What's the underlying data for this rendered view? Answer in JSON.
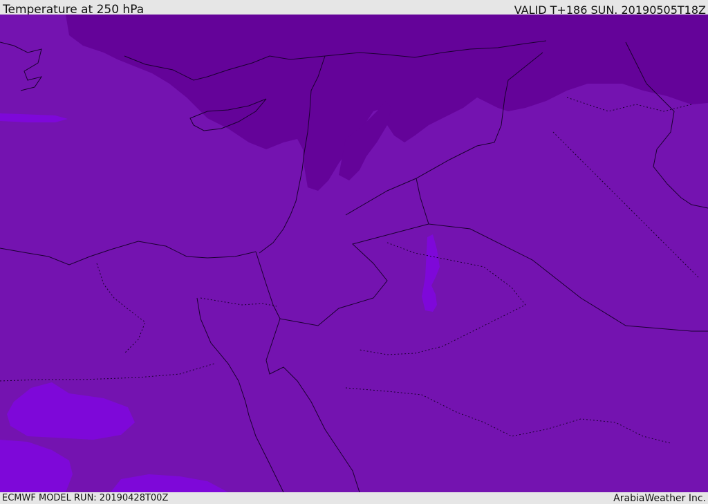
{
  "header": {
    "title": "Temperature at 250 hPa",
    "valid_time": "VALID T+186 SUN. 20190505T18Z"
  },
  "footer": {
    "model_run": "ECMWF MODEL RUN: 20190428T00Z",
    "credit": "ArabiaWeather Inc."
  },
  "colors": {
    "base_fill": "#7413b0",
    "cold_fill": "#640399",
    "warm_fill": "#7e08d9",
    "border_line": "#1a0030"
  }
}
